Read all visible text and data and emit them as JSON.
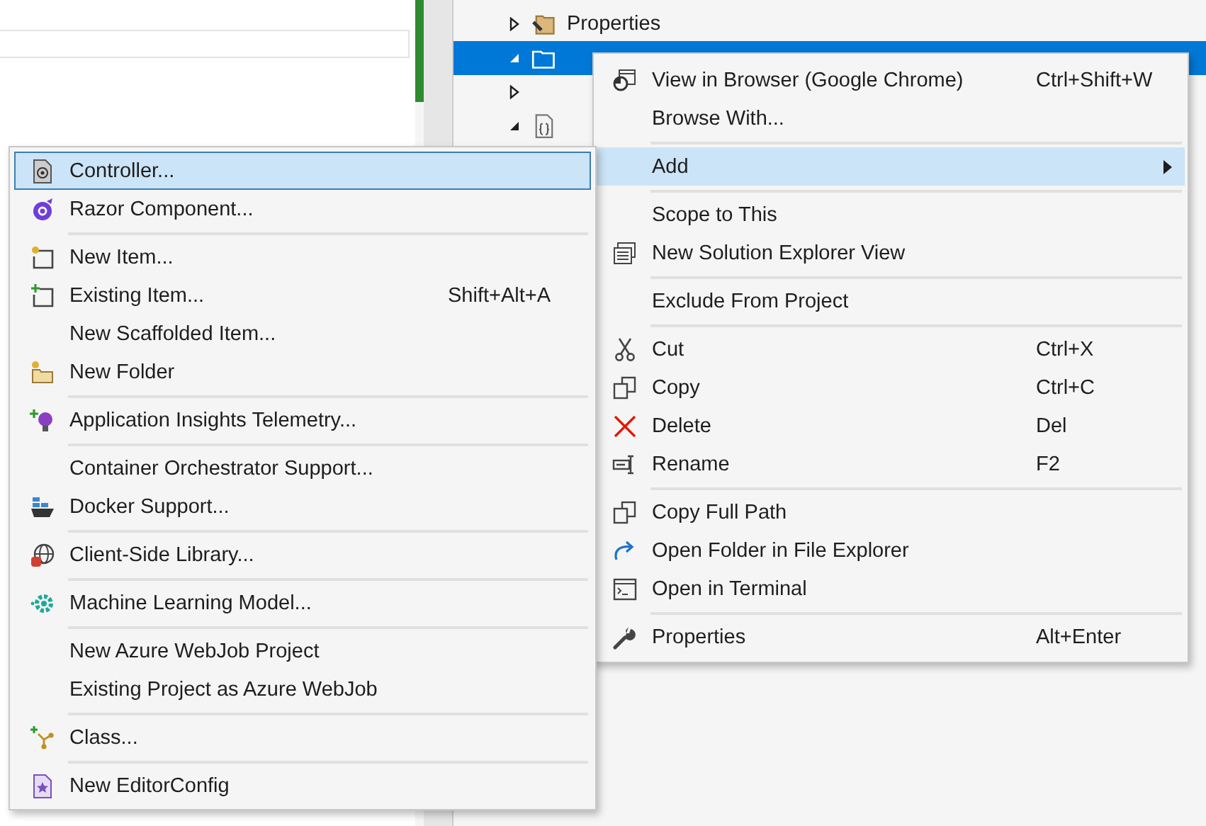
{
  "tree": [
    {
      "label": "Properties",
      "kind": "properties",
      "expanded": false,
      "selected": false
    },
    {
      "kind": "folder",
      "expanded": true,
      "selected": true
    },
    {
      "kind": "none",
      "expanded": false,
      "selected": false
    },
    {
      "kind": "json",
      "expanded": true,
      "selected": false
    }
  ],
  "context_menu": {
    "groups": [
      [
        {
          "label": "View in Browser (Google Chrome)",
          "shortcut": "Ctrl+Shift+W",
          "selected": false,
          "submenu": false
        },
        {
          "label": "Browse With...",
          "selected": false,
          "submenu": false
        }
      ],
      [
        {
          "label": "Add",
          "selected": true,
          "submenu": true
        }
      ],
      [
        {
          "label": "Scope to This",
          "selected": false,
          "submenu": false
        },
        {
          "label": "New Solution Explorer View",
          "selected": false,
          "submenu": false
        }
      ],
      [
        {
          "label": "Exclude From Project",
          "selected": false,
          "submenu": false
        }
      ],
      [
        {
          "label": "Cut",
          "shortcut": "Ctrl+X",
          "selected": false,
          "submenu": false
        },
        {
          "label": "Copy",
          "shortcut": "Ctrl+C",
          "selected": false,
          "submenu": false
        },
        {
          "label": "Delete",
          "shortcut": "Del",
          "selected": false,
          "submenu": false
        },
        {
          "label": "Rename",
          "shortcut": "F2",
          "selected": false,
          "submenu": false
        }
      ],
      [
        {
          "label": "Copy Full Path",
          "selected": false,
          "submenu": false
        },
        {
          "label": "Open Folder in File Explorer",
          "selected": false,
          "submenu": false
        },
        {
          "label": "Open in Terminal",
          "selected": false,
          "submenu": false
        }
      ],
      [
        {
          "label": "Properties",
          "shortcut": "Alt+Enter",
          "selected": false,
          "submenu": false
        }
      ]
    ]
  },
  "add_submenu": {
    "groups": [
      [
        {
          "label": "Controller...",
          "selected": true
        },
        {
          "label": "Razor Component...",
          "selected": false
        }
      ],
      [
        {
          "label": "New Item...",
          "selected": false
        },
        {
          "label": "Existing Item...",
          "shortcut": "Shift+Alt+A",
          "selected": false
        },
        {
          "label": "New Scaffolded Item...",
          "selected": false
        },
        {
          "label": "New Folder",
          "selected": false
        }
      ],
      [
        {
          "label": "Application Insights Telemetry...",
          "selected": false
        }
      ],
      [
        {
          "label": "Container Orchestrator Support...",
          "selected": false
        },
        {
          "label": "Docker Support...",
          "selected": false
        }
      ],
      [
        {
          "label": "Client-Side Library...",
          "selected": false
        }
      ],
      [
        {
          "label": "Machine Learning Model...",
          "selected": false
        }
      ],
      [
        {
          "label": "New Azure WebJob Project",
          "selected": false
        },
        {
          "label": "Existing Project as Azure WebJob",
          "selected": false
        }
      ],
      [
        {
          "label": "Class...",
          "selected": false
        }
      ],
      [
        {
          "label": "New EditorConfig",
          "selected": false
        }
      ]
    ]
  }
}
